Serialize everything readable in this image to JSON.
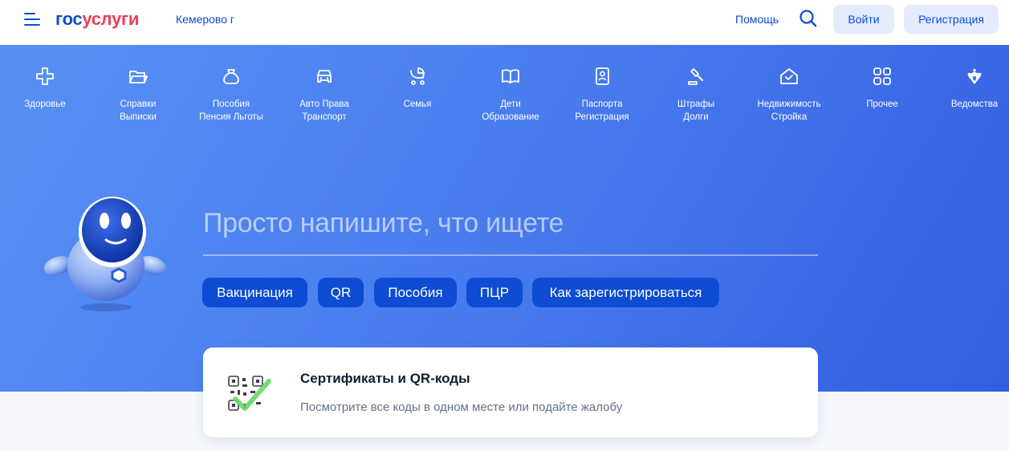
{
  "header": {
    "logo_part1": "гос",
    "logo_part2": "услуги",
    "city": "Кемерово г",
    "help": "Помощь",
    "login": "Войти",
    "register": "Регистрация"
  },
  "categories": [
    {
      "line1": "Здоровье",
      "line2": "",
      "icon": "health-cross-icon"
    },
    {
      "line1": "Справки",
      "line2": "Выписки",
      "icon": "folder-icon"
    },
    {
      "line1": "Пособия",
      "line2": "Пенсия Льготы",
      "icon": "money-bag-icon"
    },
    {
      "line1": "Авто Права",
      "line2": "Транспорт",
      "icon": "car-icon"
    },
    {
      "line1": "Семья",
      "line2": "",
      "icon": "stroller-icon"
    },
    {
      "line1": "Дети",
      "line2": "Образование",
      "icon": "book-icon"
    },
    {
      "line1": "Паспорта",
      "line2": "Регистрация",
      "icon": "passport-icon"
    },
    {
      "line1": "Штрафы",
      "line2": "Долги",
      "icon": "gavel-icon"
    },
    {
      "line1": "Недвижимость",
      "line2": "Стройка",
      "icon": "house-icon"
    },
    {
      "line1": "Прочее",
      "line2": "",
      "icon": "grid-icon"
    },
    {
      "line1": "Ведомства",
      "line2": "",
      "icon": "coat-of-arms-icon"
    }
  ],
  "search": {
    "placeholder": "Просто напишите, что ищете"
  },
  "chips": [
    "Вакцинация",
    "QR",
    "Пособия",
    "ПЦР",
    "Как зарегистрироваться"
  ],
  "card": {
    "title": "Сертификаты и QR-коды",
    "description": "Посмотрите все коды в одном месте или подайте жалобу"
  },
  "colors": {
    "brand_blue": "#0d4cd3",
    "brand_red": "#ee3f58",
    "hero_start": "#5790f4",
    "hero_end": "#335ee2",
    "button_bg": "#e3ebfc"
  }
}
